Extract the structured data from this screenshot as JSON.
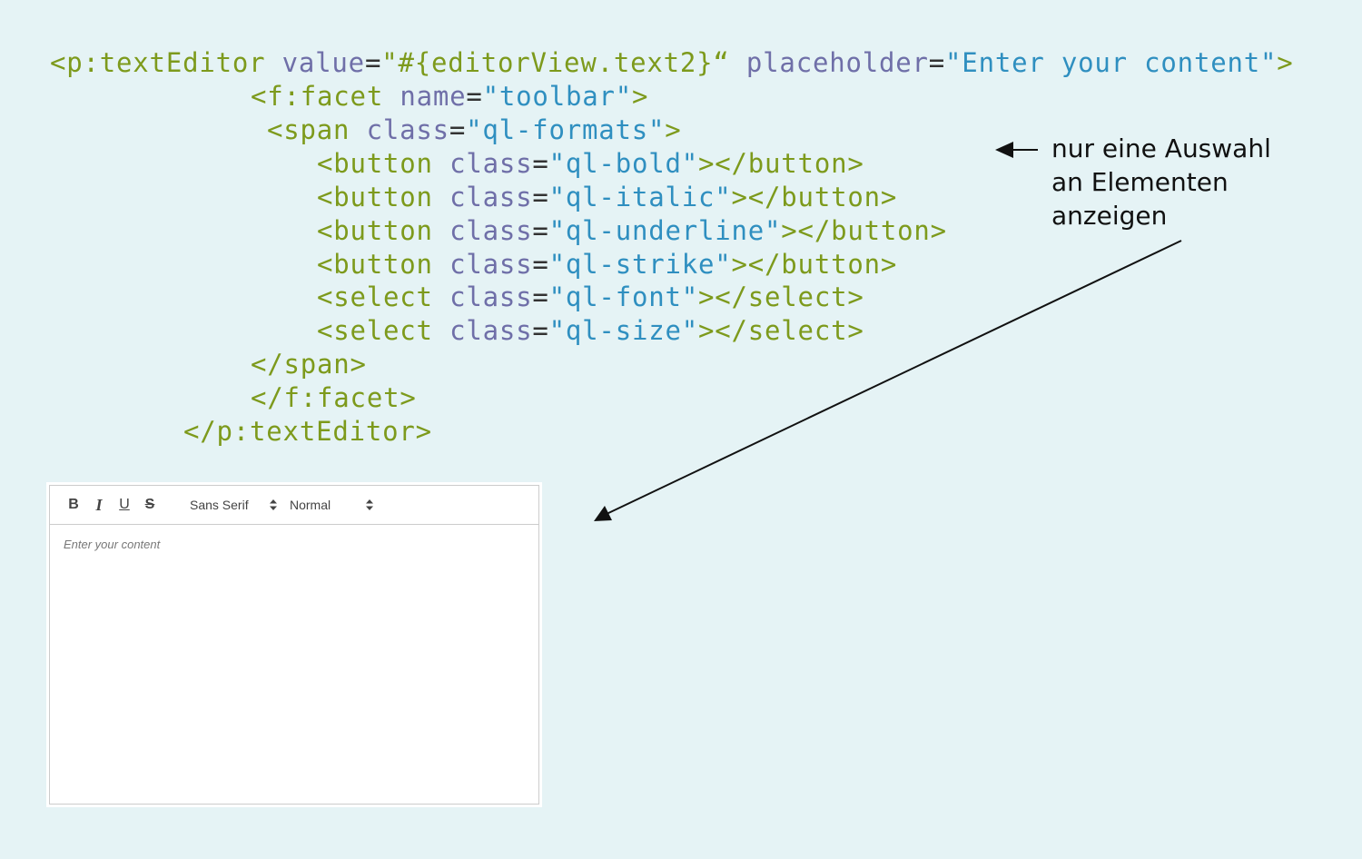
{
  "code": {
    "lines": [
      [
        {
          "t": "<p:textEditor",
          "c": "tag"
        },
        {
          "t": " value",
          "c": "attr"
        },
        {
          "t": "=",
          "c": "eq"
        },
        {
          "t": "\"#{editorView.text2}“",
          "c": "tag"
        },
        {
          "t": " placeholder",
          "c": "attr"
        },
        {
          "t": "=",
          "c": "eq"
        },
        {
          "t": "\"Enter your content\"",
          "c": "str"
        },
        {
          "t": ">",
          "c": "tag"
        }
      ],
      [
        {
          "t": "<f:facet",
          "c": "tag"
        },
        {
          "t": " name",
          "c": "attr"
        },
        {
          "t": "=",
          "c": "eq"
        },
        {
          "t": "\"toolbar\"",
          "c": "str"
        },
        {
          "t": ">",
          "c": "tag"
        }
      ],
      [
        {
          "t": "<span",
          "c": "tag"
        },
        {
          "t": " class",
          "c": "attr"
        },
        {
          "t": "=",
          "c": "eq"
        },
        {
          "t": "\"ql-formats\"",
          "c": "str"
        },
        {
          "t": ">",
          "c": "tag"
        }
      ],
      [
        {
          "t": "<button",
          "c": "tag"
        },
        {
          "t": " class",
          "c": "attr"
        },
        {
          "t": "=",
          "c": "eq"
        },
        {
          "t": "\"ql-bold\"",
          "c": "str"
        },
        {
          "t": "></button>",
          "c": "tag"
        }
      ],
      [
        {
          "t": "<button",
          "c": "tag"
        },
        {
          "t": " class",
          "c": "attr"
        },
        {
          "t": "=",
          "c": "eq"
        },
        {
          "t": "\"ql-italic\"",
          "c": "str"
        },
        {
          "t": "></button>",
          "c": "tag"
        }
      ],
      [
        {
          "t": "<button",
          "c": "tag"
        },
        {
          "t": " class",
          "c": "attr"
        },
        {
          "t": "=",
          "c": "eq"
        },
        {
          "t": "\"ql-underline\"",
          "c": "str"
        },
        {
          "t": "></button>",
          "c": "tag"
        }
      ],
      [
        {
          "t": "<button",
          "c": "tag"
        },
        {
          "t": " class",
          "c": "attr"
        },
        {
          "t": "=",
          "c": "eq"
        },
        {
          "t": "\"ql-strike\"",
          "c": "str"
        },
        {
          "t": "></button>",
          "c": "tag"
        }
      ],
      [
        {
          "t": "<select",
          "c": "tag"
        },
        {
          "t": " class",
          "c": "attr"
        },
        {
          "t": "=",
          "c": "eq"
        },
        {
          "t": "\"ql-font\"",
          "c": "str"
        },
        {
          "t": "></select>",
          "c": "tag"
        }
      ],
      [
        {
          "t": "<select",
          "c": "tag"
        },
        {
          "t": " class",
          "c": "attr"
        },
        {
          "t": "=",
          "c": "eq"
        },
        {
          "t": "\"ql-size\"",
          "c": "str"
        },
        {
          "t": "></select>",
          "c": "tag"
        }
      ],
      [
        {
          "t": "</span>",
          "c": "tag"
        }
      ],
      [
        {
          "t": "</f:facet>",
          "c": "tag"
        }
      ],
      [
        {
          "t": "</p:textEditor>",
          "c": "tag"
        }
      ]
    ]
  },
  "annotation": {
    "lines": [
      "nur eine Auswahl",
      "an Elementen",
      "anzeigen"
    ]
  },
  "editor": {
    "toolbar": {
      "bold": "B",
      "italic": "I",
      "underline": "U",
      "strike": "S",
      "font": "Sans Serif",
      "size": "Normal"
    },
    "placeholder": "Enter your content"
  },
  "colors": {
    "background": "#e5f3f5",
    "tag": "#7d9a1c",
    "attribute": "#6f6fa8",
    "string": "#2f8fc0"
  }
}
